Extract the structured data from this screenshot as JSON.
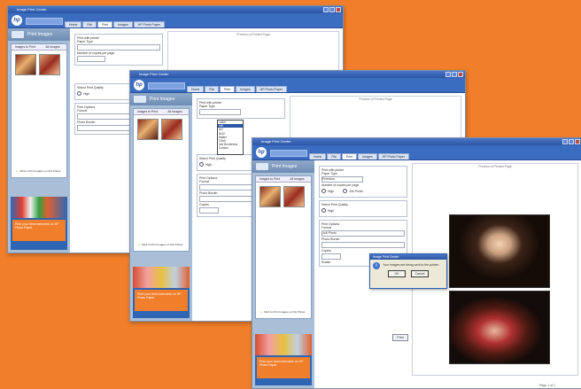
{
  "window_title": "Image Print Center",
  "tabs": [
    "Home",
    "File",
    "Print",
    "Images",
    "HP Photo Paper"
  ],
  "sidebar": {
    "header": "Print Images",
    "subtabs": [
      "Images to Print",
      "All Images"
    ],
    "tip": "Click to Print Images on this Printer",
    "promo_text": "Print your best memories on HP Photo Paper",
    "promo_link": "Learn more"
  },
  "form": {
    "printer_label": "Print with printer",
    "paper_label": "Paper Type",
    "paper_value": "Premium",
    "layout_label": "Number of copies per page",
    "options_label": "Select Print Quality",
    "quality_option": "High",
    "layout_section": "Print Options",
    "format_label": "Format",
    "format_value": "4x6 Photo",
    "border_label": "Photo Border",
    "copies_label": "Copies",
    "rotate_label": "Rotate"
  },
  "dropdown_items": [
    "Letter",
    "4x6",
    "5x7",
    "8x10",
    "Wallet",
    "3.5x5",
    "4x6 Borderless",
    "Custom"
  ],
  "preview_label": "Preview of Printed Page",
  "dialog": {
    "title": "Image Print Center",
    "message": "Your images are being sent to the printer.",
    "ok": "OK",
    "cancel": "Cancel"
  },
  "print_button": "Print",
  "page_footer": "Page 1 of 1"
}
